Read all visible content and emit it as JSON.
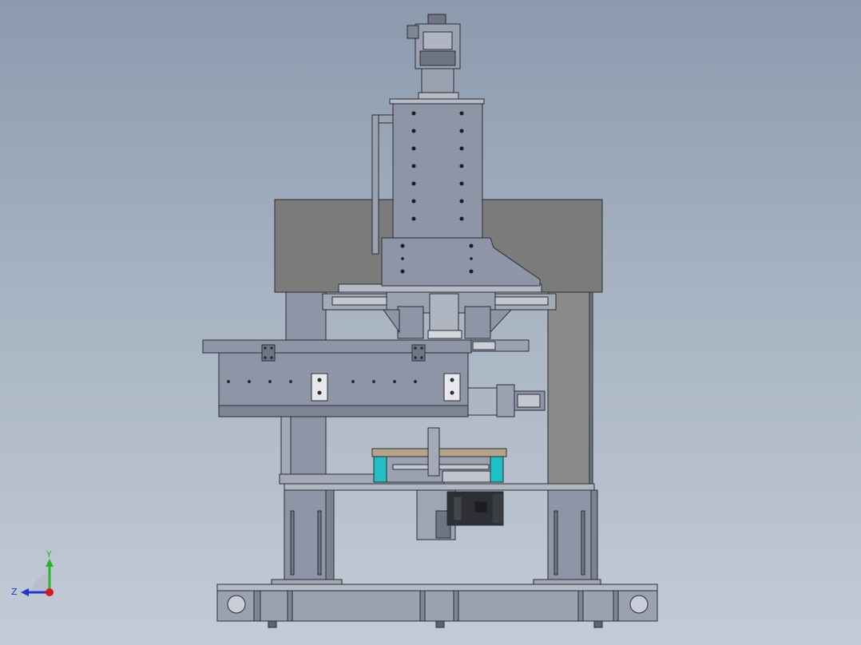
{
  "viewport": {
    "background_top": "#8c9aae",
    "background_bottom": "#c3cbd6"
  },
  "triad": {
    "x_label": "",
    "y_label": "Y",
    "z_label": "Z",
    "y_color": "#2bb52b",
    "z_color": "#2438d0",
    "origin_color": "#d81b1b"
  },
  "colors": {
    "steel": "#8e95a6",
    "steel_dark": "#6e7686",
    "plate": "#7b7b7b",
    "panel": "#8a8a8a",
    "edge": "#2a2d33",
    "cyan_part": "#1fbfc4",
    "motor_dark": "#2d2f34"
  }
}
